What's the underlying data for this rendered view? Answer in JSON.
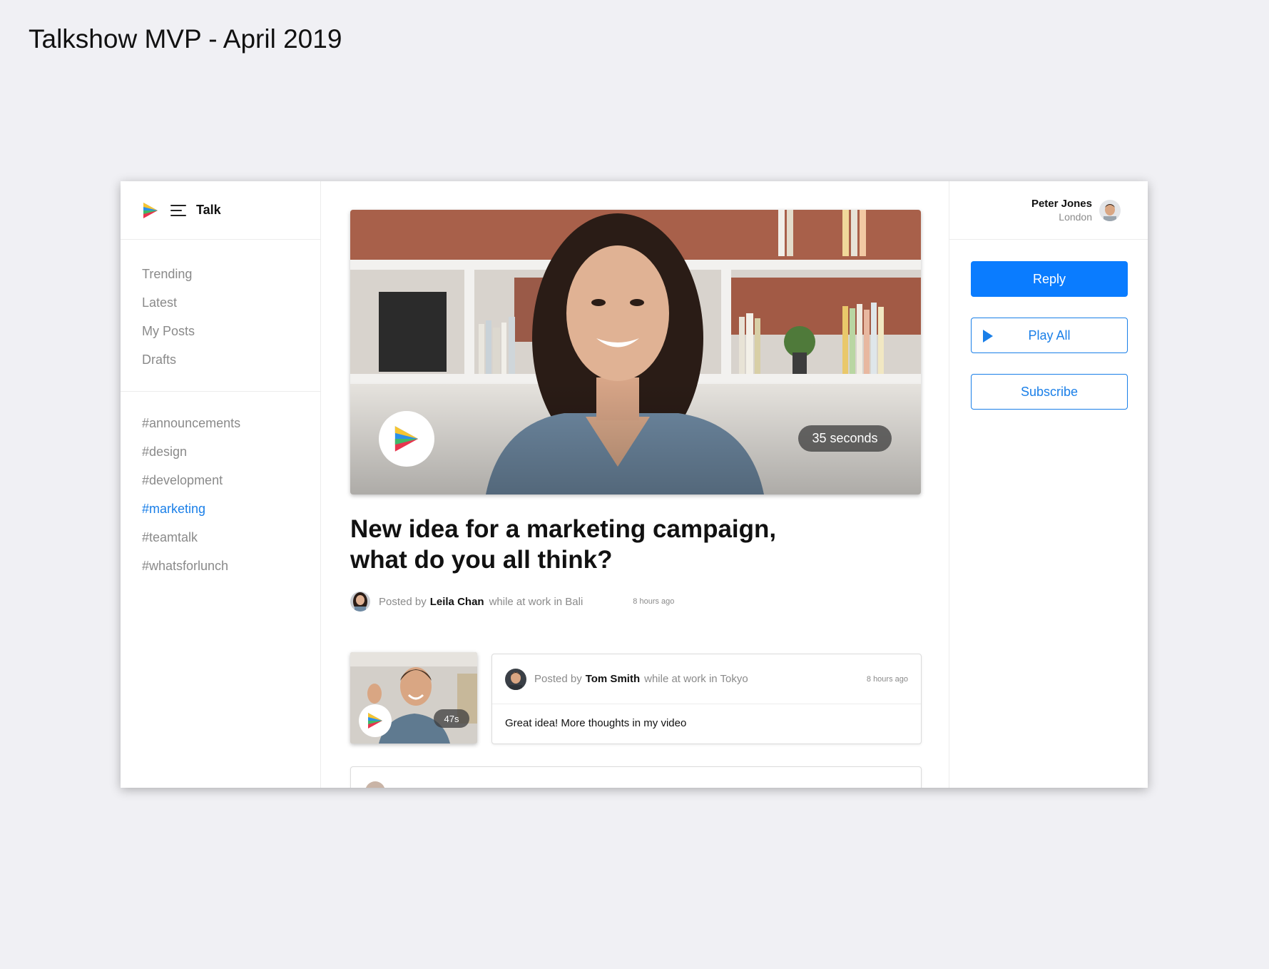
{
  "page_title": "Talkshow MVP - April 2019",
  "app": {
    "name": "Talk"
  },
  "sidebar": {
    "nav": [
      {
        "label": "Trending"
      },
      {
        "label": "Latest"
      },
      {
        "label": "My Posts"
      },
      {
        "label": "Drafts"
      }
    ],
    "channels": [
      {
        "label": "#announcements"
      },
      {
        "label": "#design"
      },
      {
        "label": "#development"
      },
      {
        "label": "#marketing",
        "active": true
      },
      {
        "label": "#teamtalk"
      },
      {
        "label": "#whatsforlunch"
      }
    ]
  },
  "main": {
    "video": {
      "duration": "35 seconds"
    },
    "post": {
      "title_line1": "New idea for a marketing campaign,",
      "title_line2": "what do you all think?",
      "posted_by": "Posted by",
      "author": "Leila Chan",
      "context": "while at work in Bali",
      "time": "8 hours ago"
    },
    "replies": [
      {
        "thumb_duration": "47s",
        "posted_by": "Posted by",
        "author": "Tom Smith",
        "context": "while at work in Tokyo",
        "time": "8 hours ago",
        "text": "Great idea! More thoughts in my video"
      }
    ]
  },
  "user": {
    "name": "Peter Jones",
    "location": "London"
  },
  "actions": {
    "reply": "Reply",
    "play_all": "Play All",
    "subscribe": "Subscribe"
  },
  "colors": {
    "accent": "#0a7cff",
    "active_link": "#1a7fe8",
    "background": "#f0f0f4",
    "logo_red": "#e8344e",
    "logo_yellow": "#f7c531",
    "logo_green": "#3fb86b",
    "logo_blue": "#2b8fe8"
  }
}
